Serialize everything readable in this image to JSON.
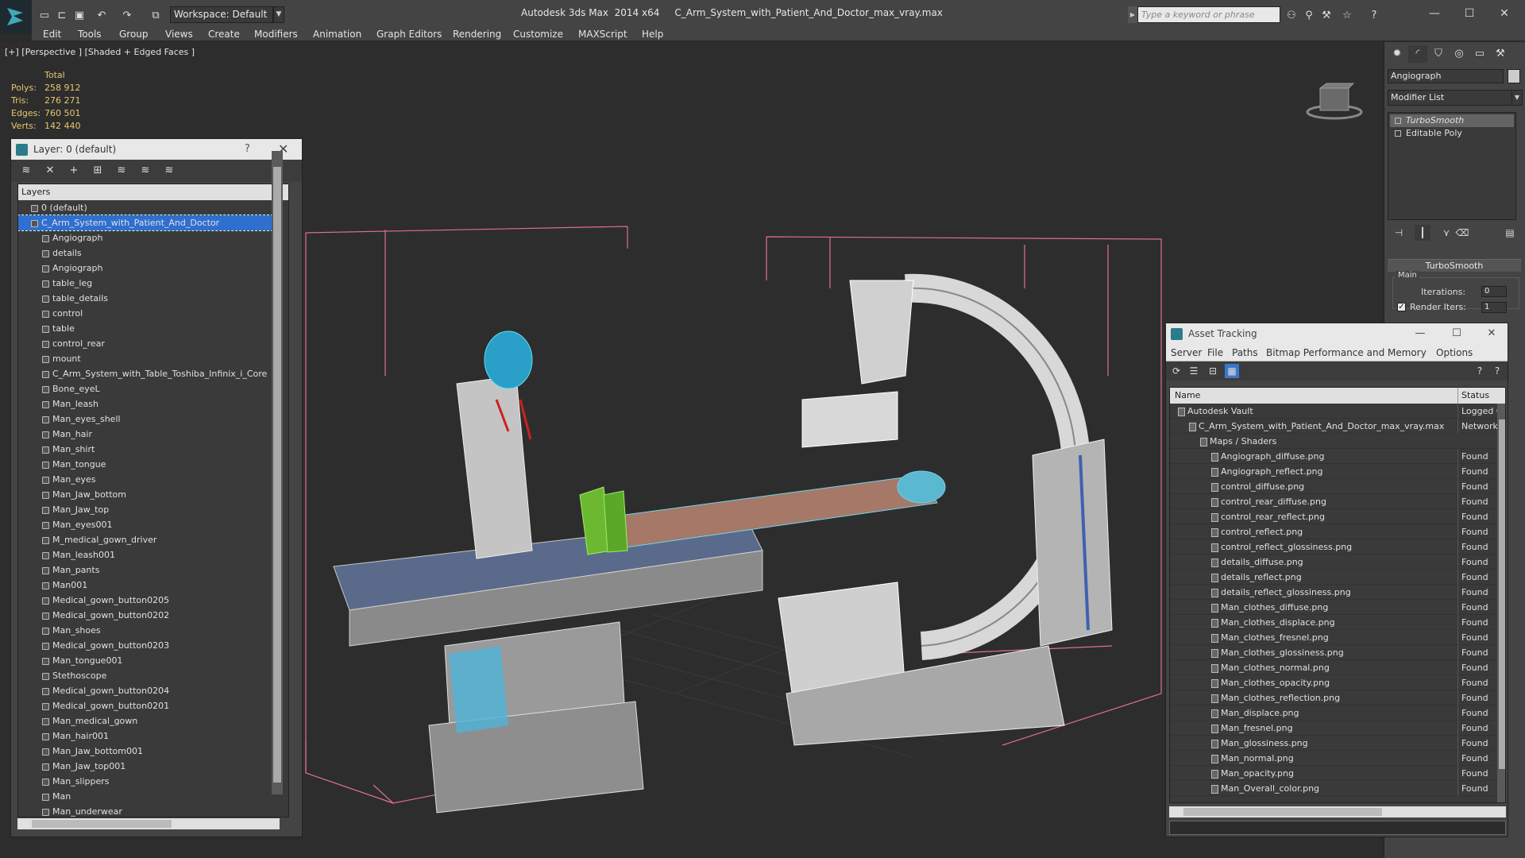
{
  "titlebar": {
    "workspace": "Workspace: Default",
    "title": "Autodesk 3ds Max  2014 x64     C_Arm_System_with_Patient_And_Doctor_max_vray.max",
    "search_placeholder": "Type a keyword or phrase"
  },
  "menu": [
    "Edit",
    "Tools",
    "Group",
    "Views",
    "Create",
    "Modifiers",
    "Animation",
    "Graph Editors",
    "Rendering",
    "Customize",
    "MAXScript",
    "Help"
  ],
  "viewport": {
    "label": "[+] [Perspective ] [Shaded + Edged Faces ]",
    "stats_header": "Total",
    "stats": [
      {
        "label": "Polys:",
        "value": "258 912"
      },
      {
        "label": "Tris:",
        "value": "276 271"
      },
      {
        "label": "Edges:",
        "value": "760 501"
      },
      {
        "label": "Verts:",
        "value": "142 440"
      }
    ]
  },
  "layer_panel": {
    "title": "Layer: 0 (default)",
    "help": "?",
    "header": "Layers",
    "rows": [
      {
        "label": "0 (default)",
        "indent": 0
      },
      {
        "label": "C_Arm_System_with_Patient_And_Doctor",
        "indent": 0,
        "selected": true
      },
      {
        "label": "Angiograph",
        "indent": 1
      },
      {
        "label": "details",
        "indent": 1
      },
      {
        "label": "Angiograph",
        "indent": 1
      },
      {
        "label": "table_leg",
        "indent": 1
      },
      {
        "label": "table_details",
        "indent": 1
      },
      {
        "label": "control",
        "indent": 1
      },
      {
        "label": "table",
        "indent": 1
      },
      {
        "label": "control_rear",
        "indent": 1
      },
      {
        "label": "mount",
        "indent": 1
      },
      {
        "label": "C_Arm_System_with_Table_Toshiba_Infinix_i_Core",
        "indent": 1
      },
      {
        "label": "Bone_eyeL",
        "indent": 1
      },
      {
        "label": "Man_leash",
        "indent": 1
      },
      {
        "label": "Man_eyes_shell",
        "indent": 1
      },
      {
        "label": "Man_hair",
        "indent": 1
      },
      {
        "label": "Man_shirt",
        "indent": 1
      },
      {
        "label": "Man_tongue",
        "indent": 1
      },
      {
        "label": "Man_eyes",
        "indent": 1
      },
      {
        "label": "Man_Jaw_bottom",
        "indent": 1
      },
      {
        "label": "Man_Jaw_top",
        "indent": 1
      },
      {
        "label": "Man_eyes001",
        "indent": 1
      },
      {
        "label": "M_medical_gown_driver",
        "indent": 1
      },
      {
        "label": "Man_leash001",
        "indent": 1
      },
      {
        "label": "Man_pants",
        "indent": 1
      },
      {
        "label": "Man001",
        "indent": 1
      },
      {
        "label": "Medical_gown_button0205",
        "indent": 1
      },
      {
        "label": "Medical_gown_button0202",
        "indent": 1
      },
      {
        "label": "Man_shoes",
        "indent": 1
      },
      {
        "label": "Medical_gown_button0203",
        "indent": 1
      },
      {
        "label": "Man_tongue001",
        "indent": 1
      },
      {
        "label": "Stethoscope",
        "indent": 1
      },
      {
        "label": "Medical_gown_button0204",
        "indent": 1
      },
      {
        "label": "Medical_gown_button0201",
        "indent": 1
      },
      {
        "label": "Man_medical_gown",
        "indent": 1
      },
      {
        "label": "Man_hair001",
        "indent": 1
      },
      {
        "label": "Man_Jaw_bottom001",
        "indent": 1
      },
      {
        "label": "Man_Jaw_top001",
        "indent": 1
      },
      {
        "label": "Man_slippers",
        "indent": 1
      },
      {
        "label": "Man",
        "indent": 1
      },
      {
        "label": "Man_underwear",
        "indent": 1
      }
    ]
  },
  "command_panel": {
    "object_name": "Angiograph",
    "modifier_list": "Modifier List",
    "stack": [
      "TurboSmooth",
      "Editable Poly"
    ],
    "rollout": "TurboSmooth",
    "group": "Main",
    "iterations_label": "Iterations:",
    "iterations_value": "0",
    "render_iters_label": "Render Iters:",
    "render_iters_value": "1",
    "render_iters_checked": "✓"
  },
  "asset_tracking": {
    "title": "Asset Tracking",
    "menu": [
      "Server",
      "File",
      "Paths",
      "Bitmap Performance and Memory",
      "Options"
    ],
    "col_name": "Name",
    "col_status": "Status",
    "rows": [
      {
        "name": "Autodesk Vault",
        "status": "Logged O",
        "indent": 1
      },
      {
        "name": "C_Arm_System_with_Patient_And_Doctor_max_vray.max",
        "status": "Network",
        "indent": 2
      },
      {
        "name": "Maps / Shaders",
        "status": "",
        "indent": 3
      },
      {
        "name": "Angiograph_diffuse.png",
        "status": "Found",
        "indent": 4
      },
      {
        "name": "Angiograph_reflect.png",
        "status": "Found",
        "indent": 4
      },
      {
        "name": "control_diffuse.png",
        "status": "Found",
        "indent": 4
      },
      {
        "name": "control_rear_diffuse.png",
        "status": "Found",
        "indent": 4
      },
      {
        "name": "control_rear_reflect.png",
        "status": "Found",
        "indent": 4
      },
      {
        "name": "control_reflect.png",
        "status": "Found",
        "indent": 4
      },
      {
        "name": "control_reflect_glossiness.png",
        "status": "Found",
        "indent": 4
      },
      {
        "name": "details_diffuse.png",
        "status": "Found",
        "indent": 4
      },
      {
        "name": "details_reflect.png",
        "status": "Found",
        "indent": 4
      },
      {
        "name": "details_reflect_glossiness.png",
        "status": "Found",
        "indent": 4
      },
      {
        "name": "Man_clothes_diffuse.png",
        "status": "Found",
        "indent": 4
      },
      {
        "name": "Man_clothes_displace.png",
        "status": "Found",
        "indent": 4
      },
      {
        "name": "Man_clothes_fresnel.png",
        "status": "Found",
        "indent": 4
      },
      {
        "name": "Man_clothes_glossiness.png",
        "status": "Found",
        "indent": 4
      },
      {
        "name": "Man_clothes_normal.png",
        "status": "Found",
        "indent": 4
      },
      {
        "name": "Man_clothes_opacity.png",
        "status": "Found",
        "indent": 4
      },
      {
        "name": "Man_clothes_reflection.png",
        "status": "Found",
        "indent": 4
      },
      {
        "name": "Man_displace.png",
        "status": "Found",
        "indent": 4
      },
      {
        "name": "Man_fresnel.png",
        "status": "Found",
        "indent": 4
      },
      {
        "name": "Man_glossiness.png",
        "status": "Found",
        "indent": 4
      },
      {
        "name": "Man_normal.png",
        "status": "Found",
        "indent": 4
      },
      {
        "name": "Man_opacity.png",
        "status": "Found",
        "indent": 4
      },
      {
        "name": "Man_Overall_color.png",
        "status": "Found",
        "indent": 4
      }
    ]
  },
  "colors": {
    "selection": "#2f6fd0",
    "stats": "#e6c870",
    "bbox": "#e0708a",
    "wire_cyan": "#3fd3f0"
  }
}
